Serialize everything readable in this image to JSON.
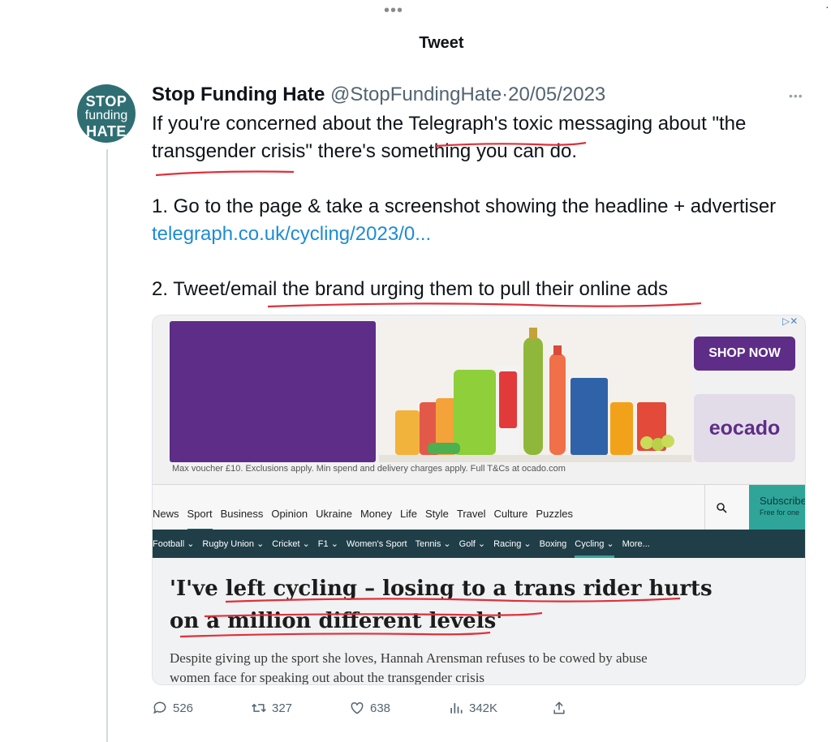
{
  "header": {
    "title": "Tweet"
  },
  "tweet": {
    "avatar": {
      "line1": "STOP",
      "line2": "funding",
      "line3": "HATE"
    },
    "author_name": "Stop Funding Hate",
    "author_handle": "@StopFundingHate",
    "separator": "·",
    "date": "20/05/2023",
    "more_label": "•••",
    "text_line1": "If you're concerned about the Telegraph's toxic messaging about \"the",
    "text_line2": "transgender crisis\" there's something you can do.",
    "text_line3": "1. Go to the page & take a screenshot showing the headline + advertiser",
    "link": "telegraph.co.uk/cycling/2023/0...",
    "text_line4": "2. Tweet/email the brand urging them to pull their online ads"
  },
  "screenshot": {
    "ad": {
      "shop_now": "SHOP NOW",
      "brand": "ocado",
      "disclaimer": "Max voucher £10. Exclusions apply. Min spend and delivery charges apply. Full T&Cs at ocado.com",
      "brand_color": "#5e2d87"
    },
    "nav": {
      "items": [
        "News",
        "Sport",
        "Business",
        "Opinion",
        "Ukraine",
        "Money",
        "Life",
        "Style",
        "Travel",
        "Culture",
        "Puzzles"
      ],
      "active": "Sport",
      "subscribe": "Subscribe",
      "subscribe_sub": "Free for one"
    },
    "subnav": {
      "items": [
        "Football ⌄",
        "Rugby Union ⌄",
        "Cricket ⌄",
        "F1 ⌄",
        "Women's Sport",
        "Tennis ⌄",
        "Golf ⌄",
        "Racing ⌄",
        "Boxing",
        "Cycling ⌄",
        "More..."
      ],
      "active": "Cycling ⌄"
    },
    "headline_line1": "'I've left cycling – losing to a trans rider hurts",
    "headline_line2": "on a million different levels'",
    "standfirst_line1": "Despite giving up the sport she loves, Hannah Arensman refuses to be cowed by abuse",
    "standfirst_line2": "women face for speaking out about the transgender crisis"
  },
  "actions": {
    "replies": "526",
    "retweets": "327",
    "likes": "638",
    "views": "342K"
  },
  "colors": {
    "link": "#1d8bd6",
    "annotation": "#e0303a",
    "avatar_bg": "#2f6f73"
  }
}
